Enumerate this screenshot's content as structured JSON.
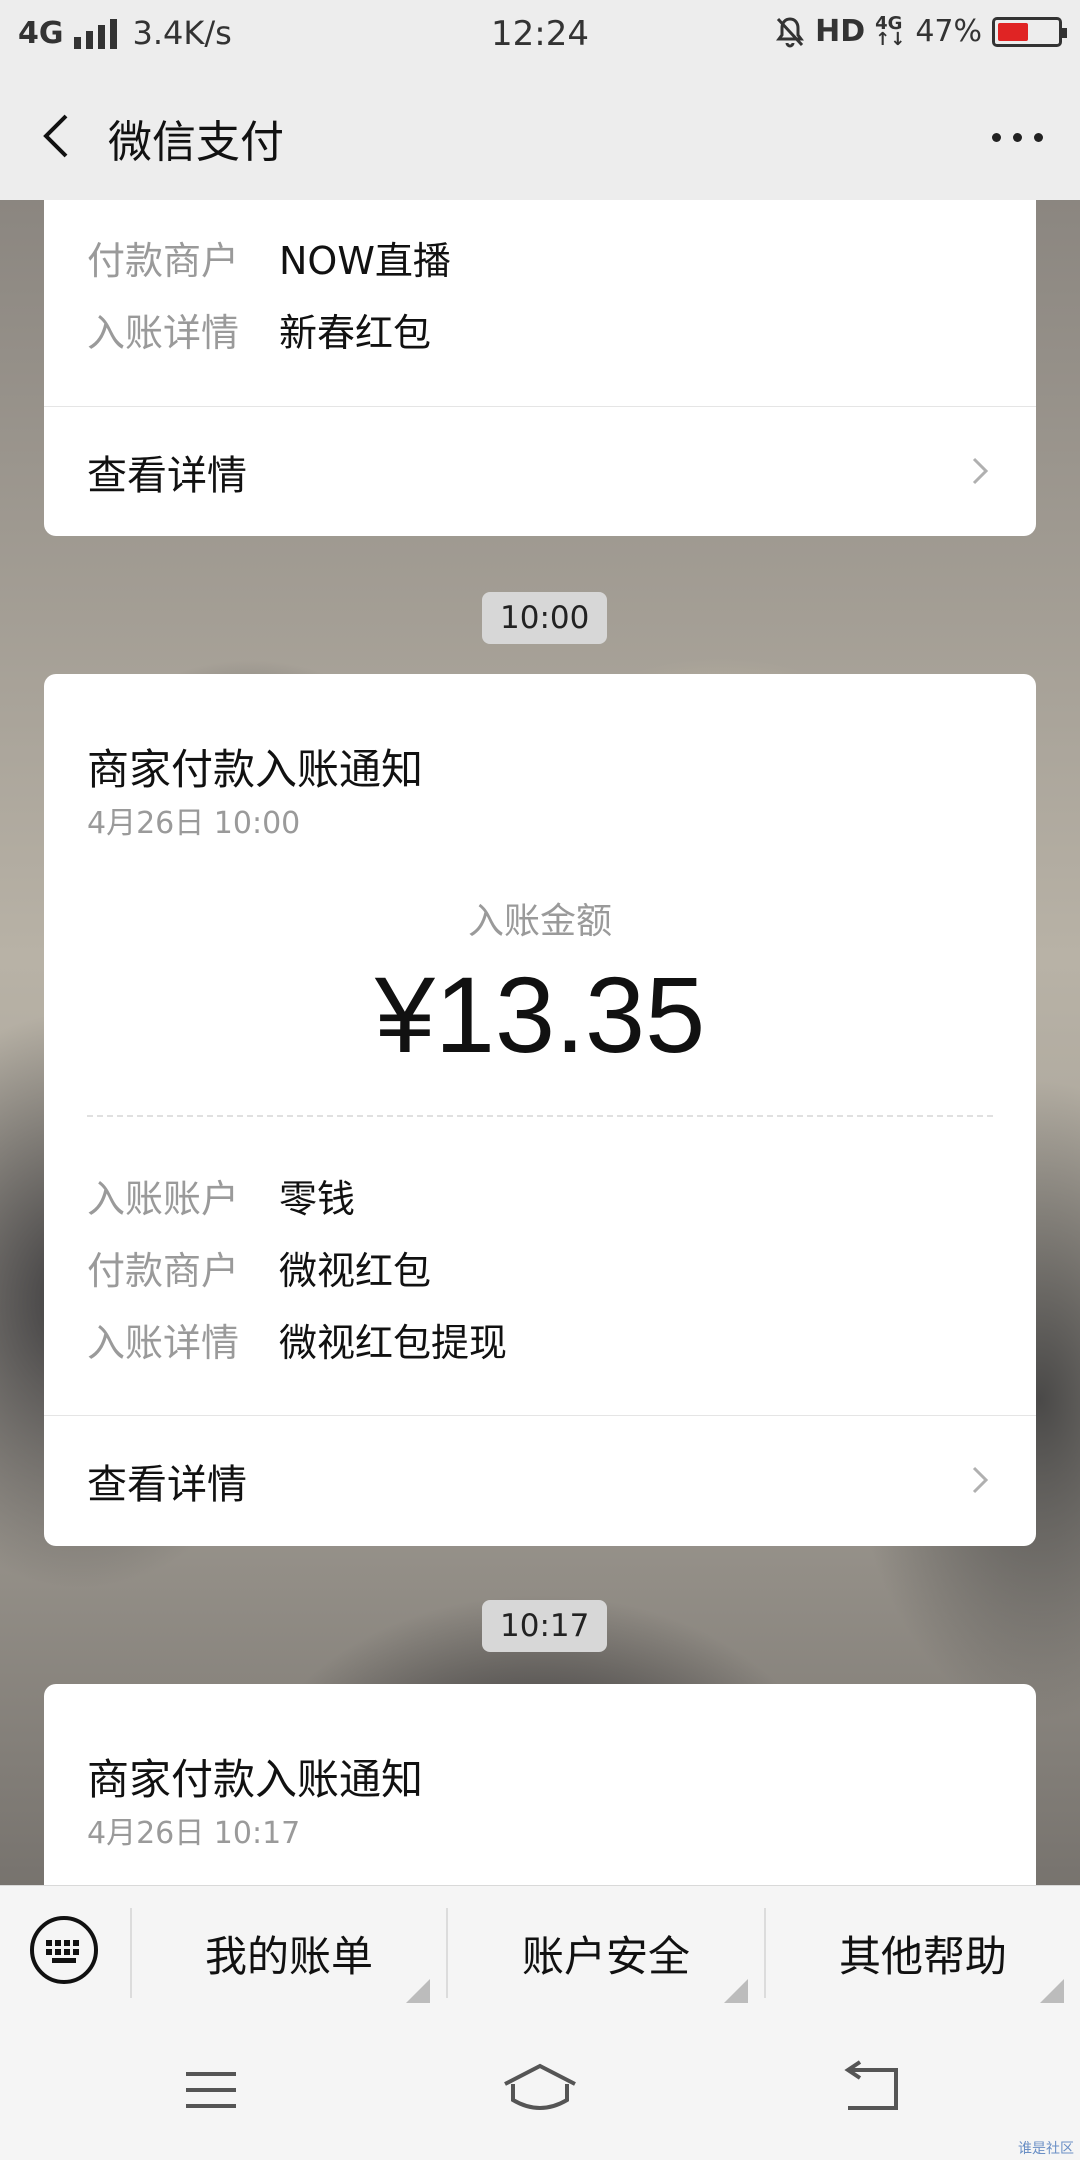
{
  "status_bar": {
    "network": "4G",
    "speed": "3.4K/s",
    "time": "12:24",
    "hd": "HD",
    "net_small": "4G",
    "battery": "47%",
    "battery_level": 0.47
  },
  "header": {
    "title": "微信支付"
  },
  "card1": {
    "rows": [
      {
        "key": "付款商户",
        "value": "NOW直播"
      },
      {
        "key": "入账详情",
        "value": "新春红包"
      }
    ],
    "detail_label": "查看详情"
  },
  "time1": "10:00",
  "card2": {
    "title": "商家付款入账通知",
    "date": "4月26日  10:00",
    "amount_label": "入账金额",
    "amount": "¥13.35",
    "rows": [
      {
        "key": "入账账户",
        "value": "零钱"
      },
      {
        "key": "付款商户",
        "value": "微视红包"
      },
      {
        "key": "入账详情",
        "value": "微视红包提现"
      }
    ],
    "detail_label": "查看详情"
  },
  "time2": "10:17",
  "card3": {
    "title": "商家付款入账通知",
    "date": "4月26日  10:17"
  },
  "menu": [
    "我的账单",
    "账户安全",
    "其他帮助"
  ],
  "watermark": "谁是社区"
}
